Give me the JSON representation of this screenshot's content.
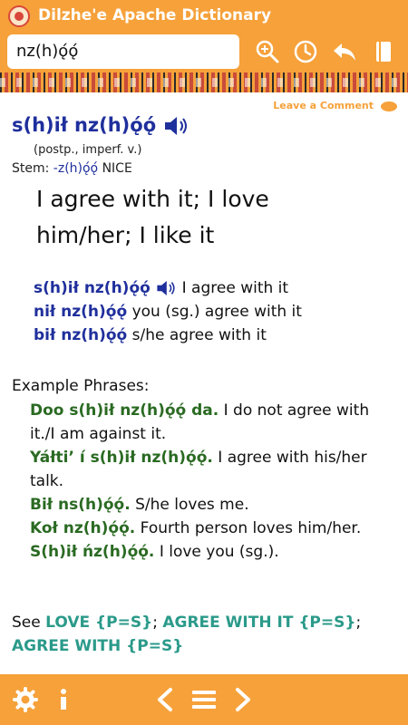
{
  "app": {
    "title": "Dilzhe'e Apache Dictionary"
  },
  "search": {
    "value": "nz(h)ǫ́ǫ́"
  },
  "toolbar": {
    "icons": [
      "search-icon",
      "history-icon",
      "back-arrow-icon",
      "book-icon"
    ]
  },
  "leave_comment": "Leave a Comment",
  "entry": {
    "headword": "s(h)ił nz(h)ǫ́ǫ́",
    "grammar": "(postp., imperf. v.)",
    "stem_label": "Stem:",
    "stem_word": "-z(h)ǫ́ǫ́",
    "stem_meaning": "NICE",
    "gloss": "I agree with it; I love him/her; I like it"
  },
  "conjugations": [
    {
      "word": "s(h)ił nz(h)ǫ́ǫ́",
      "meaning": "I agree with it",
      "speaker": true
    },
    {
      "word": "nił nz(h)ǫ́ǫ́",
      "meaning": "you (sg.) agree with it",
      "speaker": false
    },
    {
      "word": "bił nz(h)ǫ́ǫ́",
      "meaning": "s/he agree with it",
      "speaker": false
    }
  ],
  "examples_title": "Example Phrases:",
  "examples": [
    {
      "word": "Doo s(h)ił nz(h)ǫ́ǫ́ da.",
      "meaning": "I do not agree with it./I am against it."
    },
    {
      "word": "Yáłti’ í s(h)ił nz(h)ǫ́ǫ́.",
      "meaning": "I agree with his/her talk."
    },
    {
      "word": "Bił ns(h)ǫ́ǫ́.",
      "meaning": "S/he loves me."
    },
    {
      "word": "Koł nz(h)ǫ́ǫ́.",
      "meaning": "Fourth person loves him/her."
    },
    {
      "word": "S(h)ił ńz(h)ǫ́ǫ́.",
      "meaning": "I love you (sg.)."
    }
  ],
  "see": {
    "label": "See",
    "links": [
      "LOVE {P=S}",
      "AGREE WITH IT {P=S}",
      "AGREE WITH {P=S}"
    ],
    "sep": ";"
  },
  "bottom": {
    "icons": [
      "gear-icon",
      "info-icon",
      "prev-icon",
      "menu-icon",
      "next-icon"
    ]
  },
  "colors": {
    "accent": "#f6a13a",
    "headword": "#1f2f9c",
    "example": "#2a6a22",
    "link": "#2b9a8a"
  }
}
